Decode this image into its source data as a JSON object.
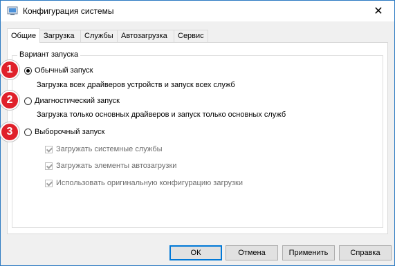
{
  "window": {
    "title": "Конфигурация системы",
    "close_label": "✕"
  },
  "tabs": [
    {
      "label": "Общие",
      "active": true
    },
    {
      "label": "Загрузка"
    },
    {
      "label": "Службы"
    },
    {
      "label": "Автозагрузка"
    },
    {
      "label": "Сервис"
    }
  ],
  "group": {
    "legend": "Вариант запуска",
    "options": [
      {
        "label": "Обычный запуск",
        "description": "Загрузка всех драйверов устройств и запуск всех служб",
        "checked": true,
        "badge": "1"
      },
      {
        "label": "Диагностический запуск",
        "description": "Загрузка только основных драйверов и запуск только основных служб",
        "checked": false,
        "badge": "2"
      },
      {
        "label": "Выборочный запуск",
        "checked": false,
        "badge": "3"
      }
    ],
    "selective_options": [
      {
        "label": "Загружать системные службы",
        "checked": true
      },
      {
        "label": "Загружать элементы автозагрузки",
        "checked": true
      },
      {
        "label": "Использовать оригинальную конфигурацию загрузки",
        "checked": true
      }
    ]
  },
  "buttons": {
    "ok": "ОК",
    "cancel": "Отмена",
    "apply": "Применить",
    "help": "Справка"
  },
  "colors": {
    "badge": "#e0212b",
    "accent": "#0078d7"
  }
}
